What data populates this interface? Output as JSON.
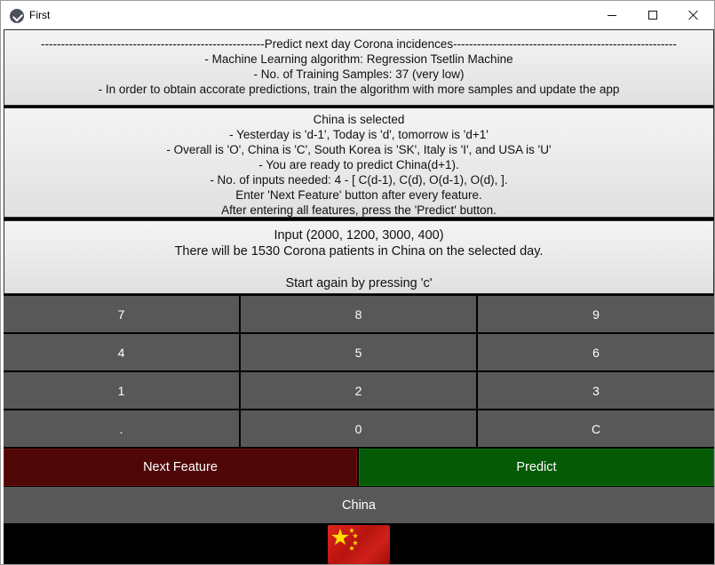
{
  "window": {
    "title": "First"
  },
  "info_panel": {
    "lines": [
      "--------------------------------------------------------Predict next day Corona incidences--------------------------------------------------------",
      "- Machine Learning algorithm: Regression Tsetlin Machine",
      "- No. of Training Samples: 37 (very low)",
      "- In order to obtain accorate predictions, train the algorithm with more samples and update the app"
    ]
  },
  "country_panel": {
    "lines": [
      "China is selected",
      "- Yesterday is 'd-1', Today is 'd', tomorrow is 'd+1'",
      "- Overall is 'O', China is 'C', South Korea is 'SK', Italy is 'I', and USA is 'U'",
      "- You are ready to predict China(d+1).",
      "- No. of inputs needed: 4 - [ C(d-1), C(d), O(d-1), O(d),  ].",
      "Enter 'Next Feature' button after every feature.",
      "After entering all features, press the 'Predict' button."
    ]
  },
  "result_panel": {
    "input_line": "Input (2000, 1200, 3000, 400)",
    "prediction_line": "There will be 1530 Corona patients in China on the selected day.",
    "restart_line": "Start again by pressing 'c'"
  },
  "keypad": {
    "keys": [
      "7",
      "8",
      "9",
      "4",
      "5",
      "6",
      "1",
      "2",
      "3",
      ".",
      "0",
      "C"
    ]
  },
  "actions": {
    "next_feature_label": "Next Feature",
    "predict_label": "Predict",
    "next_feature_color": "#4f0606",
    "predict_color": "#045a05"
  },
  "country_button": {
    "label": "China"
  },
  "flag": {
    "icon": "china-flag-icon",
    "color": "#de2910",
    "star_color": "#ffde00"
  }
}
